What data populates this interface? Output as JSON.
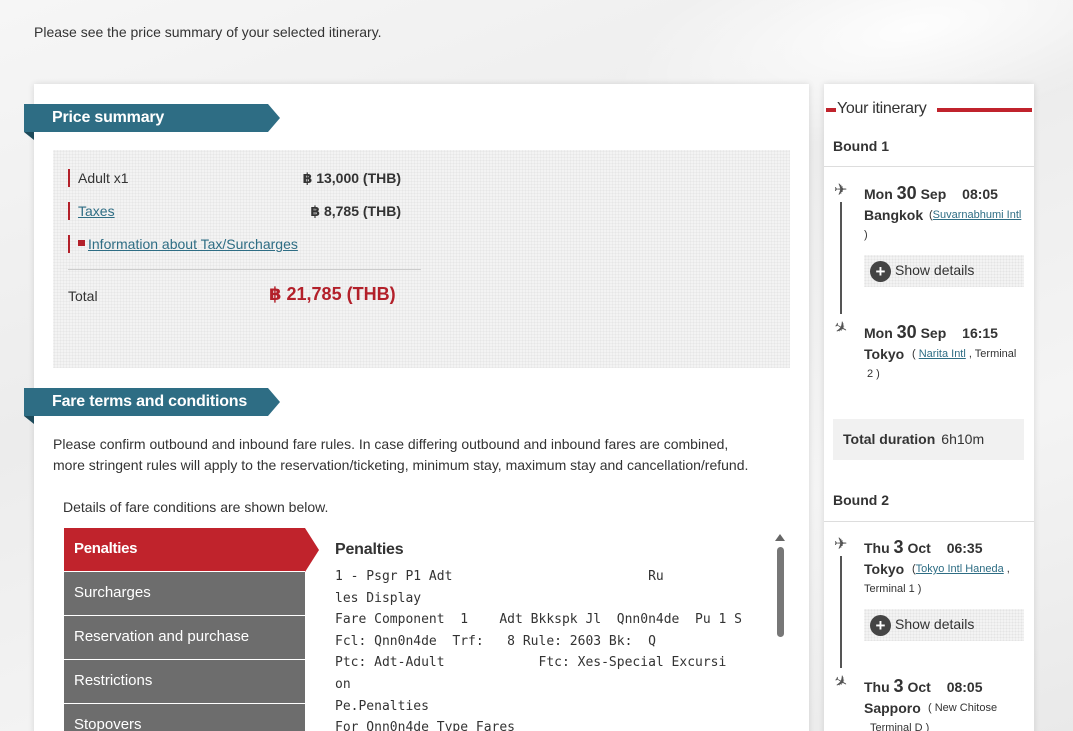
{
  "intro": "Please see the price summary of your selected itinerary.",
  "price_summary": {
    "title": "Price summary",
    "adult_label": "Adult x1",
    "adult_value": "฿ 13,000 (THB)",
    "taxes_label": "Taxes",
    "taxes_value": "฿ 8,785 (THB)",
    "info_link": "Information about Tax/Surcharges",
    "total_label": "Total",
    "total_value": "฿ 21,785 (THB)"
  },
  "fare_terms": {
    "title": "Fare terms and conditions",
    "description_line1": "Please confirm outbound and inbound fare rules. In case differing outbound and inbound fares are combined,",
    "description_line2": "more stringent rules will apply to the reservation/ticketing, minimum stay, maximum stay and cancellation/refund.",
    "details_intro": "Details of fare conditions are shown below.",
    "tabs": [
      {
        "label": "Penalties",
        "active": true
      },
      {
        "label": "Surcharges",
        "active": false
      },
      {
        "label": "Reservation and purchase",
        "active": false
      },
      {
        "label": "Restrictions",
        "active": false
      },
      {
        "label": "Stopovers",
        "active": false
      }
    ],
    "rules_title": "Penalties",
    "rules_text": "1 - Psgr P1 Adt                         Ru\nles Display\nFare Component  1    Adt Bkkspk Jl  Qnn0n4de  Pu 1 S\nFcl: Qnn0n4de  Trf:   8 Rule: 2603 Bk:  Q\nPtc: Adt-Adult            Ftc: Xes-Special Excursi\non\nPe.Penalties\nFor Qnn0n4de Type Fares"
  },
  "itinerary": {
    "title": "Your itinerary",
    "bound1": {
      "label": "Bound 1",
      "departure": {
        "weekday": "Mon",
        "day": "30",
        "month": "Sep",
        "time": "08:05",
        "city": "Bangkok",
        "airport": "Suvarnabhumi Intl",
        "close": ")"
      },
      "show_details": "Show details",
      "arrival": {
        "weekday": "Mon",
        "day": "30",
        "month": "Sep",
        "time": "16:15",
        "city": "Tokyo",
        "airport": "Narita Intl",
        "terminal": ", Terminal",
        "terminal_num": "2 )"
      },
      "duration_label": "Total duration",
      "duration_value": "6h10m"
    },
    "bound2": {
      "label": "Bound 2",
      "departure": {
        "weekday": "Thu",
        "day": "3",
        "month": "Oct",
        "time": "06:35",
        "city": "Tokyo",
        "airport": "Tokyo Intl Haneda",
        "terminal": "Terminal   1 )"
      },
      "show_details": "Show details",
      "arrival": {
        "weekday": "Thu",
        "day": "3",
        "month": "Oct",
        "time": "08:05",
        "city": "Sapporo",
        "airport": "( New Chitose",
        "terminal": "Terminal  D )"
      }
    }
  },
  "colors": {
    "accent_red": "#c0232c",
    "ribbon_teal": "#2e6d84",
    "tab_gray": "#6d6d6d"
  }
}
